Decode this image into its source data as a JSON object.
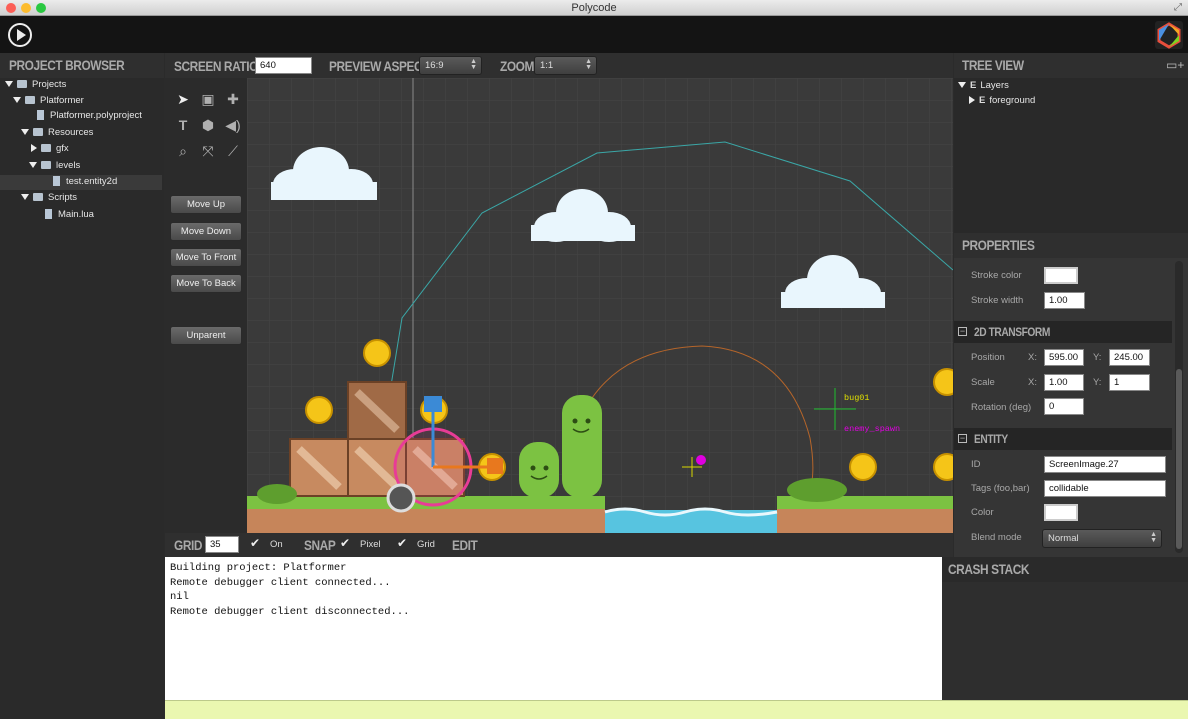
{
  "window": {
    "title": "Polycode"
  },
  "project_browser": {
    "title": "PROJECT BROWSER",
    "items": [
      {
        "label": "Projects"
      },
      {
        "label": "Platformer"
      },
      {
        "label": "Platformer.polyproject"
      },
      {
        "label": "Resources"
      },
      {
        "label": "gfx"
      },
      {
        "label": "levels"
      },
      {
        "label": "test.entity2d"
      },
      {
        "label": "Scripts"
      },
      {
        "label": "Main.lua"
      }
    ]
  },
  "editor_toolbar": {
    "screen_ratio_label": "SCREEN RATIO",
    "screen_ratio_value": "640",
    "preview_aspect_label": "PREVIEW ASPECT",
    "preview_aspect_value": "16:9",
    "zoom_label": "ZOOM",
    "zoom_value": "1:1"
  },
  "side_buttons": {
    "move_up": "Move Up",
    "move_down": "Move Down",
    "move_to_front": "Move To Front",
    "move_to_back": "Move To Back",
    "unparent": "Unparent"
  },
  "scene": {
    "label_bug": "bug01",
    "label_spawn": "enemy_spawn"
  },
  "bottom_bar": {
    "grid_label": "GRID",
    "grid_value": "35",
    "on_label": "On",
    "snap_label": "SNAP",
    "pixel_label": "Pixel",
    "grid_check_label": "Grid",
    "edit_label": "EDIT"
  },
  "console": {
    "lines": [
      "Building project: Platformer",
      "Remote debugger client connected...",
      "nil",
      "Remote debugger client disconnected..."
    ]
  },
  "tree_view": {
    "title": "TREE VIEW",
    "items": [
      {
        "label": "Layers"
      },
      {
        "label": "foreground"
      }
    ]
  },
  "properties": {
    "title": "PROPERTIES",
    "stroke_color_label": "Stroke color",
    "stroke_width_label": "Stroke width",
    "stroke_width_value": "1.00",
    "transform_section": "2D TRANSFORM",
    "position_label": "Position",
    "position_x": "595.00",
    "position_y": "245.00",
    "scale_label": "Scale",
    "scale_x": "1.00",
    "scale_y": "1",
    "rotation_label": "Rotation (deg)",
    "rotation_value": "0",
    "x_label": "X:",
    "y_label": "Y:",
    "entity_section": "ENTITY",
    "id_label": "ID",
    "id_value": "ScreenImage.27",
    "tags_label": "Tags (foo,bar)",
    "tags_value": "collidable",
    "color_label": "Color",
    "blend_label": "Blend mode",
    "blend_value": "Normal"
  },
  "crash_stack": {
    "title": "CRASH STACK"
  }
}
